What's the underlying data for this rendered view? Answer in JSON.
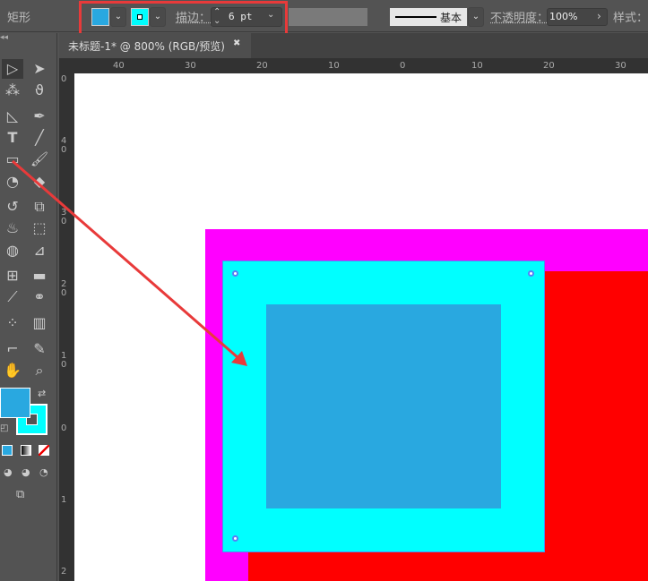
{
  "control_bar": {
    "tool_name": "矩形",
    "fill_color": "#29a8e0",
    "stroke_color": "#00ffff",
    "stroke_label": "描边：",
    "stroke_weight": "6 pt",
    "profile_label": "基本",
    "opacity_label": "不透明度：",
    "opacity_value": "100%",
    "style_label": "样式："
  },
  "document_tab": {
    "title": "未标题-1* @ 800% (RGB/预览)",
    "close": "✖"
  },
  "rulers": {
    "horizontal": [
      "40",
      "30",
      "20",
      "10",
      "0",
      "10",
      "20",
      "30"
    ],
    "vertical": [
      "0",
      "40",
      "30",
      "20",
      "10",
      "0",
      "1",
      "2"
    ]
  },
  "artwork": {
    "magenta": "#ff00ff",
    "red": "#ff0000",
    "cyan": "#00ffff",
    "inner": "#29a8e0"
  },
  "annotation_color": "#e83a3a"
}
